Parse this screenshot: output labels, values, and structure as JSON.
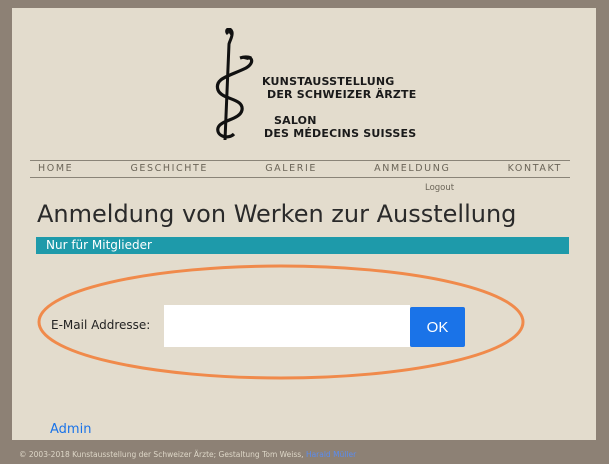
{
  "logo": {
    "line1": "KUNSTAUSSTELLUNG",
    "line2": "DER SCHWEIZER ÄRZTE",
    "line3": "SALON",
    "line4": "DES MÉDECINS SUISSES"
  },
  "nav": {
    "items": [
      "HOME",
      "GESCHICHTE",
      "GALERIE",
      "ANMELDUNG",
      "KONTAKT"
    ]
  },
  "logout": "Logout",
  "page_title": "Anmeldung von Werken zur Ausstellung",
  "members_bar": "Nur für Mitglieder",
  "form": {
    "email_label": "E-Mail Addresse:",
    "email_value": "",
    "ok_label": "OK"
  },
  "admin_link": "Admin",
  "footer": {
    "text": "© 2003-2018 Kunstausstellung der Schweizer Ärzte; Gestaltung Tom Weiss,",
    "link": "Harald Müller"
  },
  "colors": {
    "background": "#8d8175",
    "page": "#e3dccd",
    "accent_bar": "#1e9aaa",
    "button": "#1a73e8",
    "highlight": "#f08a4b"
  }
}
